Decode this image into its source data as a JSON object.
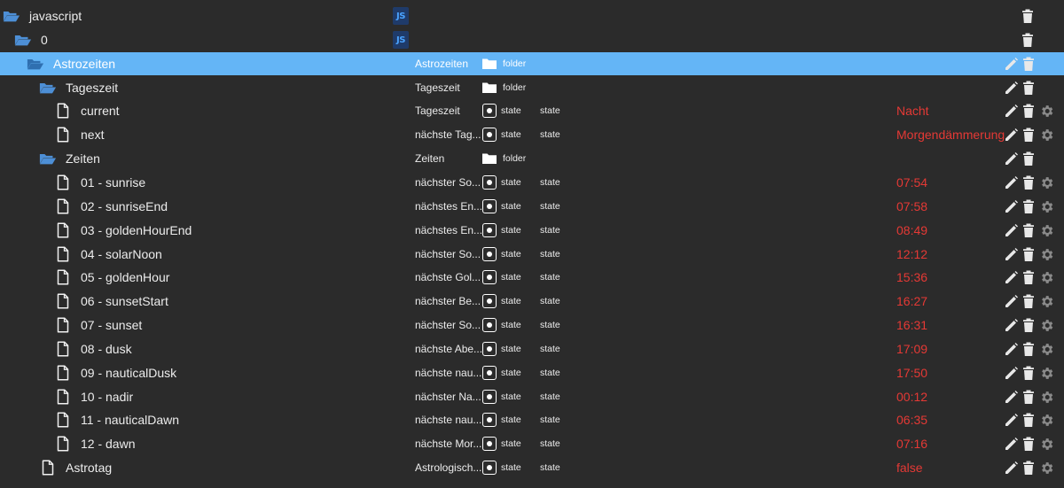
{
  "colors": {
    "selected_row": "#64b5f6",
    "background": "#2b2b2b",
    "value_red": "#e53935",
    "folder_blue": "#4d8fd6"
  },
  "tree": [
    {
      "name": "javascript",
      "kind": "folder-open",
      "level": 0,
      "js": true,
      "actions": [
        "delete"
      ]
    },
    {
      "name": "0",
      "kind": "folder-open",
      "level": 1,
      "js": true,
      "actions": [
        "delete"
      ]
    },
    {
      "name": "Astrozeiten",
      "kind": "folder-open",
      "level": 2,
      "selected": true,
      "desc": "Astrozeiten",
      "type": "folder",
      "actions": [
        "edit",
        "delete"
      ]
    },
    {
      "name": "Tageszeit",
      "kind": "folder-open",
      "level": 3,
      "desc": "Tageszeit",
      "type": "folder",
      "actions": [
        "edit",
        "delete"
      ]
    },
    {
      "name": "current",
      "kind": "file",
      "level": 4,
      "desc": "Tageszeit",
      "type": "state",
      "role": "state",
      "value": "Nacht",
      "actions": [
        "edit",
        "delete",
        "settings"
      ]
    },
    {
      "name": "next",
      "kind": "file",
      "level": 4,
      "desc": "nächste Tag...",
      "type": "state",
      "role": "state",
      "value": "Morgendämmerung",
      "actions": [
        "edit",
        "delete",
        "settings"
      ]
    },
    {
      "name": "Zeiten",
      "kind": "folder-open",
      "level": 3,
      "desc": "Zeiten",
      "type": "folder",
      "actions": [
        "edit",
        "delete"
      ]
    },
    {
      "name": "01 - sunrise",
      "kind": "file",
      "level": 4,
      "desc": "nächster So...",
      "type": "state",
      "role": "state",
      "value": "07:54",
      "actions": [
        "edit",
        "delete",
        "settings"
      ]
    },
    {
      "name": "02 - sunriseEnd",
      "kind": "file",
      "level": 4,
      "desc": "nächstes En...",
      "type": "state",
      "role": "state",
      "value": "07:58",
      "actions": [
        "edit",
        "delete",
        "settings"
      ]
    },
    {
      "name": "03 - goldenHourEnd",
      "kind": "file",
      "level": 4,
      "desc": "nächstes En...",
      "type": "state",
      "role": "state",
      "value": "08:49",
      "actions": [
        "edit",
        "delete",
        "settings"
      ]
    },
    {
      "name": "04 - solarNoon",
      "kind": "file",
      "level": 4,
      "desc": "nächster So...",
      "type": "state",
      "role": "state",
      "value": "12:12",
      "actions": [
        "edit",
        "delete",
        "settings"
      ]
    },
    {
      "name": "05 - goldenHour",
      "kind": "file",
      "level": 4,
      "desc": "nächste Gol...",
      "type": "state",
      "role": "state",
      "value": "15:36",
      "actions": [
        "edit",
        "delete",
        "settings"
      ]
    },
    {
      "name": "06 - sunsetStart",
      "kind": "file",
      "level": 4,
      "desc": "nächster Be...",
      "type": "state",
      "role": "state",
      "value": "16:27",
      "actions": [
        "edit",
        "delete",
        "settings"
      ]
    },
    {
      "name": "07 - sunset",
      "kind": "file",
      "level": 4,
      "desc": "nächster So...",
      "type": "state",
      "role": "state",
      "value": "16:31",
      "actions": [
        "edit",
        "delete",
        "settings"
      ]
    },
    {
      "name": "08 - dusk",
      "kind": "file",
      "level": 4,
      "desc": "nächste Abe...",
      "type": "state",
      "role": "state",
      "value": "17:09",
      "actions": [
        "edit",
        "delete",
        "settings"
      ]
    },
    {
      "name": "09 - nauticalDusk",
      "kind": "file",
      "level": 4,
      "desc": "nächste nau...",
      "type": "state",
      "role": "state",
      "value": "17:50",
      "actions": [
        "edit",
        "delete",
        "settings"
      ]
    },
    {
      "name": "10 - nadir",
      "kind": "file",
      "level": 4,
      "desc": "nächster Na...",
      "type": "state",
      "role": "state",
      "value": "00:12",
      "actions": [
        "edit",
        "delete",
        "settings"
      ]
    },
    {
      "name": "11 - nauticalDawn",
      "kind": "file",
      "level": 4,
      "desc": "nächste nau...",
      "type": "state",
      "role": "state",
      "value": "06:35",
      "actions": [
        "edit",
        "delete",
        "settings"
      ]
    },
    {
      "name": "12 - dawn",
      "kind": "file",
      "level": 4,
      "desc": "nächste Mor...",
      "type": "state",
      "role": "state",
      "value": "07:16",
      "actions": [
        "edit",
        "delete",
        "settings"
      ]
    },
    {
      "name": "Astrotag",
      "kind": "file",
      "level": 3,
      "desc": "Astrologisch...",
      "type": "state",
      "role": "state",
      "value": "false",
      "actions": [
        "edit",
        "delete",
        "settings"
      ]
    }
  ]
}
